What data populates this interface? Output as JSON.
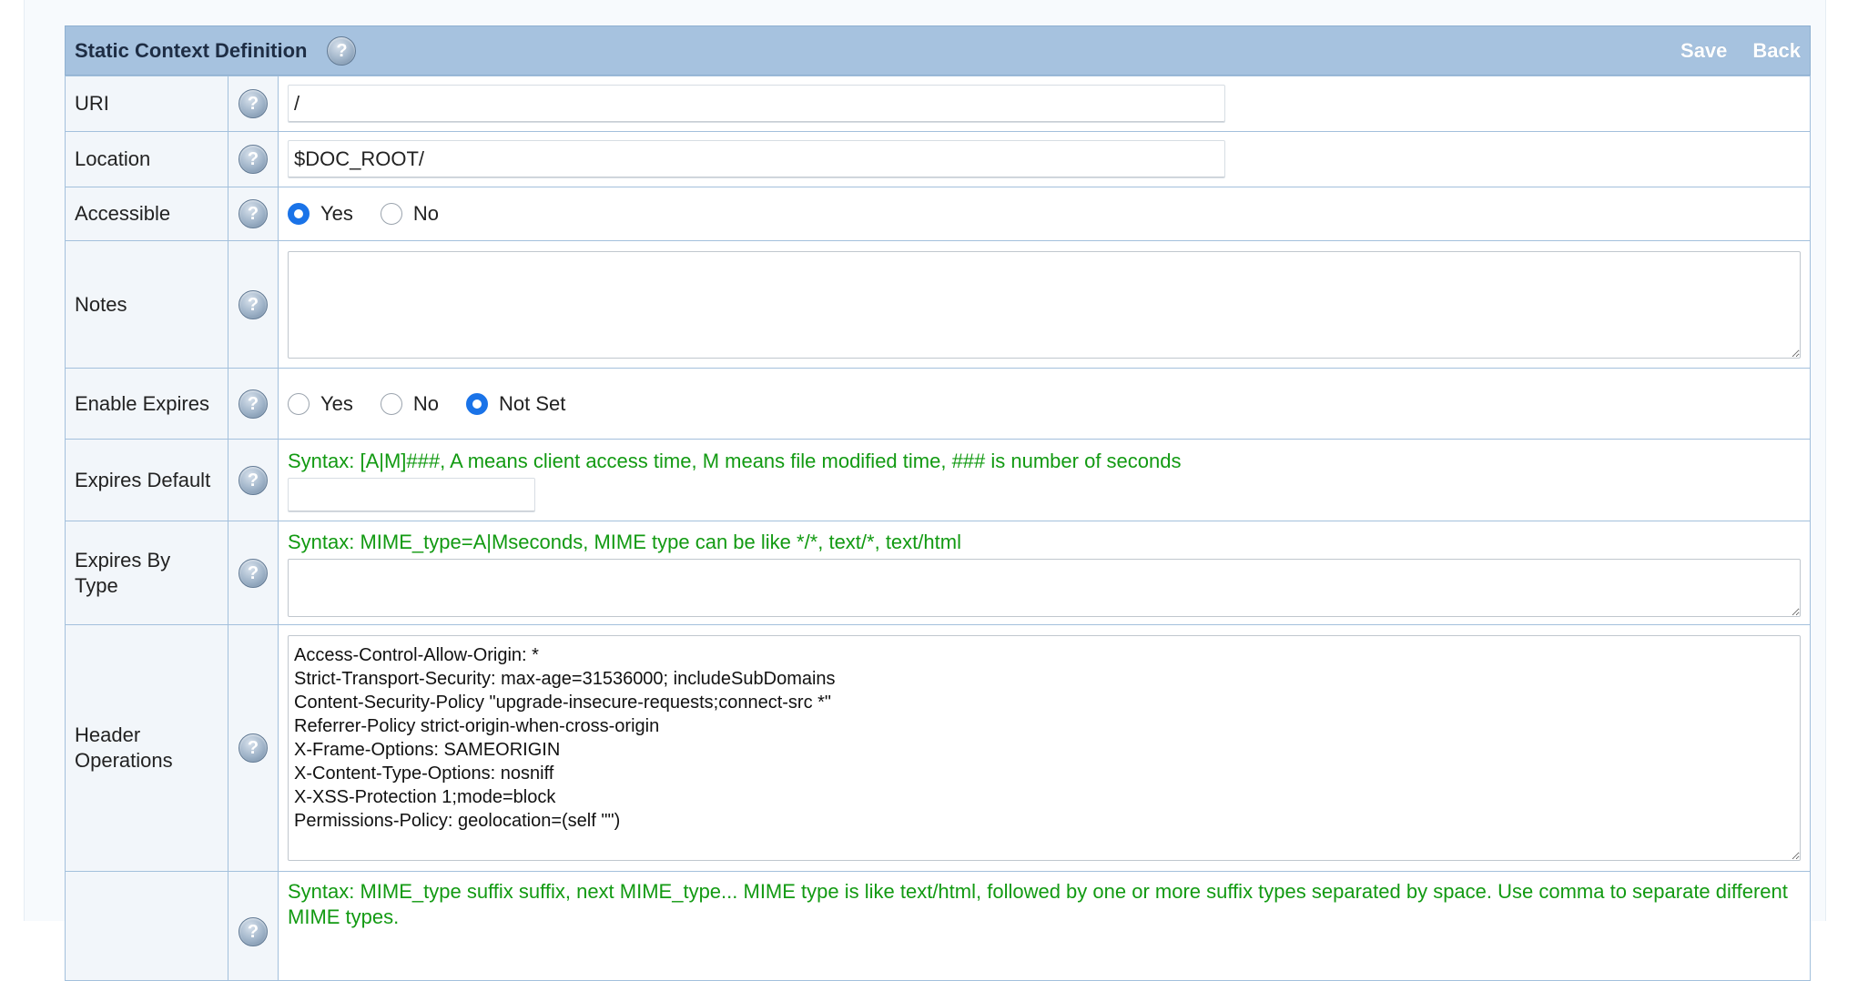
{
  "header": {
    "title": "Static Context Definition",
    "save_label": "Save",
    "back_label": "Back"
  },
  "help_glyph": "?",
  "fields": {
    "uri": {
      "label": "URI",
      "value": "/"
    },
    "location": {
      "label": "Location",
      "value": "$DOC_ROOT/"
    },
    "accessible": {
      "label": "Accessible",
      "options": [
        "Yes",
        "No"
      ],
      "selected": "Yes"
    },
    "notes": {
      "label": "Notes",
      "value": ""
    },
    "enable_expires": {
      "label": "Enable Expires",
      "options": [
        "Yes",
        "No",
        "Not Set"
      ],
      "selected": "Not Set"
    },
    "expires_default": {
      "label": "Expires Default",
      "syntax": "Syntax: [A|M]###, A means client access time, M means file modified time, ### is number of seconds",
      "value": ""
    },
    "expires_by_type": {
      "label": "Expires By Type",
      "syntax": "Syntax: MIME_type=A|Mseconds, MIME type can be like */*, text/*, text/html",
      "value": ""
    },
    "header_operations": {
      "label": "Header Operations",
      "value": "Access-Control-Allow-Origin: *\nStrict-Transport-Security: max-age=31536000; includeSubDomains\nContent-Security-Policy \"upgrade-insecure-requests;connect-src *\"\nReferrer-Policy strict-origin-when-cross-origin\nX-Frame-Options: SAMEORIGIN\nX-Content-Type-Options: nosniff\nX-XSS-Protection 1;mode=block\nPermissions-Policy: geolocation=(self \"\")"
    },
    "mime_types": {
      "label": "",
      "syntax": "Syntax: MIME_type suffix suffix, next MIME_type... MIME type is like text/html, followed by one or more suffix types separated by space. Use comma to separate different MIME types."
    }
  },
  "colors": {
    "header_bg": "#a6c2df",
    "syntax_text": "#129a12",
    "radio_selected": "#1a73e8",
    "border": "#a3c0dc"
  }
}
